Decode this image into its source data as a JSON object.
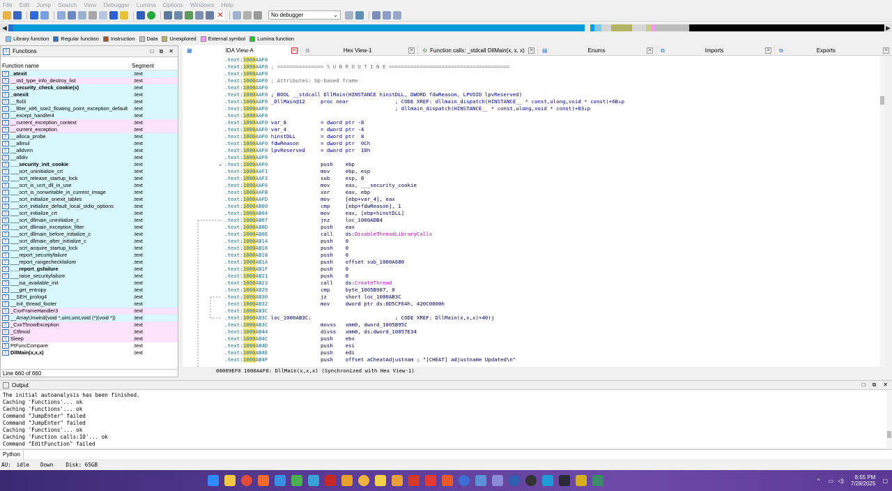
{
  "menu": [
    "File",
    "Edit",
    "Jump",
    "Search",
    "View",
    "Debugger",
    "Lumina",
    "Options",
    "Windows",
    "Help"
  ],
  "toolbar": {
    "debugger_select": "No debugger"
  },
  "legend": [
    {
      "label": "Library function",
      "color": "#7ac5f5"
    },
    {
      "label": "Regular function",
      "color": "#2b6fd1"
    },
    {
      "label": "Instruction",
      "color": "#a0522d"
    },
    {
      "label": "Data",
      "color": "#c0c0c0"
    },
    {
      "label": "Unexplored",
      "color": "#b5b56a"
    },
    {
      "label": "External symbol",
      "color": "#ff90ff"
    },
    {
      "label": "Lumina function",
      "color": "#27c227"
    }
  ],
  "functions": {
    "title": "Functions",
    "col_name": "Function name",
    "col_segment": "Segment",
    "status": "Line 660 of 660",
    "rows": [
      {
        "name": "_atexit",
        "seg": ".text",
        "kind": "lib",
        "bold": true
      },
      {
        "name": "__std_type_info_destroy_list",
        "seg": ".text",
        "kind": "ext",
        "bold": false
      },
      {
        "name": "__security_check_cookie(x)",
        "seg": ".text",
        "kind": "lib",
        "bold": true
      },
      {
        "name": "_onexit",
        "seg": ".text",
        "kind": "lib",
        "bold": true
      },
      {
        "name": "__ftol3",
        "seg": ".text",
        "kind": "lib",
        "bold": false
      },
      {
        "name": "__filter_x86_sse2_floating_point_exception_default",
        "seg": ".text",
        "kind": "lib",
        "bold": false
      },
      {
        "name": "__except_handler4",
        "seg": ".text",
        "kind": "lib",
        "bold": false
      },
      {
        "name": "__current_exception_context",
        "seg": ".text",
        "kind": "ext",
        "bold": false
      },
      {
        "name": "__current_exception",
        "seg": ".text",
        "kind": "ext",
        "bold": false
      },
      {
        "name": "__alloca_probe",
        "seg": ".text",
        "kind": "lib",
        "bold": false
      },
      {
        "name": "__allmul",
        "seg": ".text",
        "kind": "lib",
        "bold": false
      },
      {
        "name": "__alldvrm",
        "seg": ".text",
        "kind": "lib",
        "bold": false
      },
      {
        "name": "__alldiv",
        "seg": ".text",
        "kind": "lib",
        "bold": false
      },
      {
        "name": "___security_init_cookie",
        "seg": ".text",
        "kind": "lib",
        "bold": true
      },
      {
        "name": "___scrt_uninitialize_crt",
        "seg": ".text",
        "kind": "lib",
        "bold": false
      },
      {
        "name": "___scrt_release_startup_lock",
        "seg": ".text",
        "kind": "lib",
        "bold": false
      },
      {
        "name": "___scrt_is_ucrt_dll_in_use",
        "seg": ".text",
        "kind": "lib",
        "bold": false
      },
      {
        "name": "___scrt_is_nonwritable_in_current_image",
        "seg": ".text",
        "kind": "lib",
        "bold": false
      },
      {
        "name": "___scrt_initialize_onexit_tables",
        "seg": ".text",
        "kind": "lib",
        "bold": false
      },
      {
        "name": "___scrt_initialize_default_local_stdio_options",
        "seg": ".text",
        "kind": "lib",
        "bold": false
      },
      {
        "name": "___scrt_initialize_crt",
        "seg": ".text",
        "kind": "lib",
        "bold": false
      },
      {
        "name": "___scrt_dllmain_uninitialize_c",
        "seg": ".text",
        "kind": "lib",
        "bold": false
      },
      {
        "name": "___scrt_dllmain_exception_filter",
        "seg": ".text",
        "kind": "lib",
        "bold": false
      },
      {
        "name": "___scrt_dllmain_before_initialize_c",
        "seg": ".text",
        "kind": "lib",
        "bold": false
      },
      {
        "name": "___scrt_dllmain_after_initialize_c",
        "seg": ".text",
        "kind": "lib",
        "bold": false
      },
      {
        "name": "___scrt_acquire_startup_lock",
        "seg": ".text",
        "kind": "lib",
        "bold": false
      },
      {
        "name": "___report_securityfailure",
        "seg": ".text",
        "kind": "lib",
        "bold": false
      },
      {
        "name": "___report_rangecheckfailure",
        "seg": ".text",
        "kind": "lib",
        "bold": false
      },
      {
        "name": "___report_gsfailure",
        "seg": ".text",
        "kind": "lib",
        "bold": true
      },
      {
        "name": "___raise_securityfailure",
        "seg": ".text",
        "kind": "lib",
        "bold": false
      },
      {
        "name": "___isa_available_init",
        "seg": ".text",
        "kind": "lib",
        "bold": false
      },
      {
        "name": "___get_entropy",
        "seg": ".text",
        "kind": "lib",
        "bold": false
      },
      {
        "name": "__SEH_prolog4",
        "seg": ".text",
        "kind": "lib",
        "bold": false
      },
      {
        "name": "__Init_thread_footer",
        "seg": ".text",
        "kind": "lib",
        "bold": false
      },
      {
        "name": "_CxxFrameHandler3",
        "seg": ".text",
        "kind": "ext",
        "bold": false
      },
      {
        "name": "__ArrayUnwind(void *,uint,uint,void (*)(void *))",
        "seg": ".text",
        "kind": "lib",
        "bold": false
      },
      {
        "name": "_CxxThrowException",
        "seg": ".text",
        "kind": "ext",
        "bold": false
      },
      {
        "name": "_Ctfmod",
        "seg": ".text",
        "kind": "ext",
        "bold": false
      },
      {
        "name": "Sleep",
        "seg": ".text",
        "kind": "ext",
        "bold": false
      },
      {
        "name": "PtFuncCompare",
        "seg": ".text",
        "kind": "reg",
        "bold": false
      },
      {
        "name": "DllMain(x,x,x)",
        "seg": ".text",
        "kind": "reg",
        "bold": true
      }
    ]
  },
  "tabs": [
    {
      "label": "IDA View-A"
    },
    {
      "label": "Hex View-1"
    },
    {
      "label": "Function calls: _stdcall DllMain(x, x, x)"
    },
    {
      "label": "Enums"
    },
    {
      "label": "Imports"
    },
    {
      "label": "Exports"
    }
  ],
  "code": [
    {
      "seg": ".text:",
      "hl": "1000",
      "rest": "AAF0",
      "body": ""
    },
    {
      "seg": ".text:",
      "hl": "1000",
      "rest": "AAF0",
      "body": " ; =============== S U B R O U T I N E =======================================",
      "cmt": true
    },
    {
      "seg": ".text:",
      "hl": "1000",
      "rest": "AAF0",
      "body": ""
    },
    {
      "seg": ".text:",
      "hl": "1000",
      "rest": "AAF0",
      "body": " ; Attributes: bp-based frame",
      "cmt": true
    },
    {
      "seg": ".text:",
      "hl": "1000",
      "rest": "AAF0",
      "body": ""
    },
    {
      "seg": ".text:",
      "hl": "1000",
      "rest": "AAF0",
      "body": " ; BOOL __stdcall DllMain(HINSTANCE hinstDLL, DWORD fdwReason, LPVOID lpvReserved)",
      "blue": true
    },
    {
      "seg": ".text:",
      "hl": "1000",
      "rest": "AAF0",
      "body": " _DllMain@12     proc near               ; CODE XREF: dllmain_dispatch(HINSTANCE__ * const,ulong,void * const)+6B↓p",
      "blue": true
    },
    {
      "seg": ".text:",
      "hl": "1000",
      "rest": "AAF0",
      "body": "                                         ; dllmain_dispatch(HINSTANCE__ * const,ulong,void * const)+83↓p",
      "blue": true
    },
    {
      "seg": ".text:",
      "hl": "1000",
      "rest": "AAF0",
      "body": ""
    },
    {
      "seg": ".text:",
      "hl": "1000",
      "rest": "AAF0",
      "body": " var_8           = dword ptr -8",
      "blue": true
    },
    {
      "seg": ".text:",
      "hl": "1000",
      "rest": "AAF0",
      "body": " var_4           = dword ptr -4",
      "blue": true
    },
    {
      "seg": ".text:",
      "hl": "1000",
      "rest": "AAF0",
      "body": " hinstDLL        = dword ptr  8",
      "blue": true
    },
    {
      "seg": ".text:",
      "hl": "1000",
      "rest": "AAF0",
      "body": " fdwReason       = dword ptr  0Ch",
      "blue": true
    },
    {
      "seg": ".text:",
      "hl": "1000",
      "rest": "AAF0",
      "body": " lpvReserved     = dword ptr  10h",
      "blue": true
    },
    {
      "seg": ".text:",
      "hl": "1000",
      "rest": "AAF0",
      "body": ""
    },
    {
      "seg": ".text:",
      "hl": "1000",
      "rest": "AAF0",
      "body": "                 push    ebp"
    },
    {
      "seg": ".text:",
      "hl": "1000",
      "rest": "AAF1",
      "body": "                 mov     ebp, esp"
    },
    {
      "seg": ".text:",
      "hl": "1000",
      "rest": "AAF3",
      "body": "                 sub     esp, 8"
    },
    {
      "seg": ".text:",
      "hl": "1000",
      "rest": "AAF6",
      "body": "                 mov     eax, ___security_cookie"
    },
    {
      "seg": ".text:",
      "hl": "1000",
      "rest": "AAFB",
      "body": "                 xor     eax, ebp"
    },
    {
      "seg": ".text:",
      "hl": "1000",
      "rest": "AAFD",
      "body": "                 mov     [ebp+var_4], eax"
    },
    {
      "seg": ".text:",
      "hl": "1000",
      "rest": "AB00",
      "body": "                 cmp     [ebp+fdwReason], 1"
    },
    {
      "seg": ".text:",
      "hl": "1000",
      "rest": "AB04",
      "body": "                 mov     eax, [ebp+hinstDLL]"
    },
    {
      "seg": ".text:",
      "hl": "1000",
      "rest": "AB07",
      "body": "                 jnz     loc_1000ADB4"
    },
    {
      "seg": ".text:",
      "hl": "1000",
      "rest": "AB0D",
      "body": "                 push    eax"
    },
    {
      "seg": ".text:",
      "hl": "1000",
      "rest": "AB0E",
      "body": "                 call    ds:DisableThreadLibraryCalls"
    },
    {
      "seg": ".text:",
      "hl": "1000",
      "rest": "AB14",
      "body": "                 push    0"
    },
    {
      "seg": ".text:",
      "hl": "1000",
      "rest": "AB16",
      "body": "                 push    0"
    },
    {
      "seg": ".text:",
      "hl": "1000",
      "rest": "AB18",
      "body": "                 push    0"
    },
    {
      "seg": ".text:",
      "hl": "1000",
      "rest": "AB1A",
      "body": "                 push    offset sub_1000A680"
    },
    {
      "seg": ".text:",
      "hl": "1000",
      "rest": "AB1F",
      "body": "                 push    0"
    },
    {
      "seg": ".text:",
      "hl": "1000",
      "rest": "AB21",
      "body": "                 push    0"
    },
    {
      "seg": ".text:",
      "hl": "1000",
      "rest": "AB23",
      "body": "                 call    ds:CreateThread"
    },
    {
      "seg": ".text:",
      "hl": "1000",
      "rest": "AB29",
      "body": "                 cmp     byte_1005B987, 0"
    },
    {
      "seg": ".text:",
      "hl": "1000",
      "rest": "AB30",
      "body": "                 jz      short loc_1000AB3C"
    },
    {
      "seg": ".text:",
      "hl": "1000",
      "rest": "AB32",
      "body": "                 mov     dword ptr ds:0D5CF64h, 420C0000h"
    },
    {
      "seg": ".text:",
      "hl": "1000",
      "rest": "AB3C",
      "body": ""
    },
    {
      "seg": ".text:",
      "hl": "1000",
      "rest": "AB3C",
      "body": " loc_1000AB3C:                           ; CODE XREF: DllMain(x,x,x)+40↑j"
    },
    {
      "seg": ".text:",
      "hl": "1000",
      "rest": "AB3C",
      "body": "                 movss   xmm0, dword_1005B95C"
    },
    {
      "seg": ".text:",
      "hl": "1000",
      "rest": "AB44",
      "body": "                 divss   xmm0, ds:dword_10057E34"
    },
    {
      "seg": ".text:",
      "hl": "1000",
      "rest": "AB4C",
      "body": "                 push    ebx"
    },
    {
      "seg": ".text:",
      "hl": "1000",
      "rest": "AB4D",
      "body": "                 push    esi"
    },
    {
      "seg": ".text:",
      "hl": "1000",
      "rest": "AB4E",
      "body": "                 push    edi"
    },
    {
      "seg": ".text:",
      "hl": "1000",
      "rest": "AB4F",
      "body": "                 push    offset aCheatAdjustnam ; \"[CHEAT] adjustname Updated\\n\""
    }
  ],
  "code_status": "00009EF0 1000AAF0: DllMain(x,x,x) (Synchronized with Hex View-1)",
  "output": {
    "title": "Output",
    "lines": [
      "The initial autoanalysis has been finished.",
      "Caching 'Functions'... ok",
      "Caching 'Functions'... ok",
      "Command \"JumpEnter\" failed",
      "Command \"JumpEnter\" failed",
      "Caching 'Functions'... ok",
      "Caching 'Function calls:10'... ok",
      "Command \"EditFunction\" failed"
    ]
  },
  "python_label": "Python",
  "ida_status": {
    "au": "AU:",
    "state": "idle",
    "dir": "Down",
    "disk": "Disk: 65GB"
  },
  "clock": {
    "time": "8:55 PM",
    "date": "7/28/2025"
  }
}
